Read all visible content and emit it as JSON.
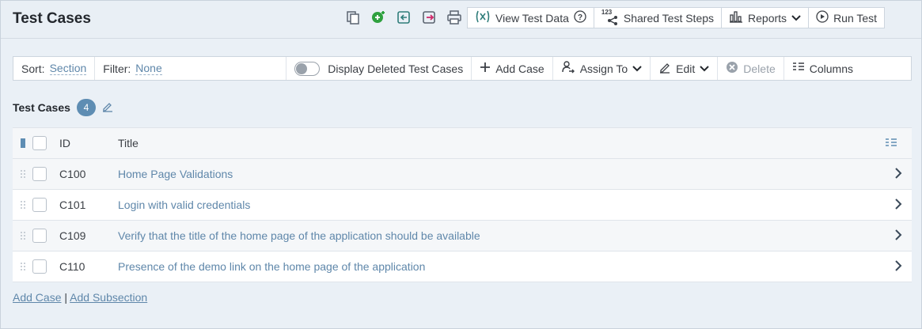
{
  "header": {
    "title": "Test Cases",
    "icons": [
      "copy-icon",
      "add-case-icon",
      "import-icon",
      "export-icon",
      "print-icon"
    ],
    "buttons": {
      "view_test_data": "View Test Data",
      "shared_test_steps": "Shared Test Steps",
      "reports": "Reports",
      "run_test": "Run Test"
    },
    "shared_steps_badge": "123"
  },
  "toolbar": {
    "sort_label": "Sort:",
    "sort_value": "Section",
    "filter_label": "Filter:",
    "filter_value": "None",
    "display_deleted": "Display Deleted Test Cases",
    "add_case": "Add Case",
    "assign_to": "Assign To",
    "edit": "Edit",
    "delete": "Delete",
    "columns": "Columns"
  },
  "section": {
    "title": "Test Cases",
    "count": "4"
  },
  "grid": {
    "headers": {
      "id": "ID",
      "title": "Title"
    },
    "rows": [
      {
        "id": "C100",
        "title": "Home Page Validations"
      },
      {
        "id": "C101",
        "title": "Login with valid credentials"
      },
      {
        "id": "C109",
        "title": "Verify that the title of the home page of the application should be available"
      },
      {
        "id": "C110",
        "title": "Presence of the demo link on the home page of the application"
      }
    ]
  },
  "footer": {
    "add_case": "Add Case",
    "separator": "|",
    "add_subsection": "Add Subsection"
  },
  "colors": {
    "accent": "#5f87aa",
    "badge": "#5e8db3",
    "green_icon": "#2fa13f",
    "pink_icon": "#d0286a",
    "background": "#eaf0f6"
  }
}
